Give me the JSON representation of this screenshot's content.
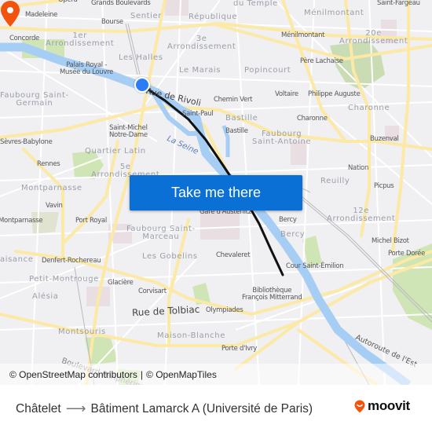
{
  "map": {
    "districts": [
      {
        "id": "sentier",
        "text": "Sentier"
      },
      {
        "id": "republique",
        "text": "République"
      },
      {
        "id": "du-temple",
        "text": "du Temple"
      },
      {
        "id": "menilmontant-dist",
        "text": "Ménilmontant"
      },
      {
        "id": "1er",
        "text": "1er\nArrondissement"
      },
      {
        "id": "3e",
        "text": "3e\nArrondissement"
      },
      {
        "id": "20e",
        "text": "20e\nArrondissement"
      },
      {
        "id": "les-halles",
        "text": "Les Halles"
      },
      {
        "id": "le-marais",
        "text": "Le Marais"
      },
      {
        "id": "popincourt",
        "text": "Popincourt"
      },
      {
        "id": "faubourg-saint-germain",
        "text": "Faubourg Saint-\nGermain"
      },
      {
        "id": "bastille-dist",
        "text": "Bastille"
      },
      {
        "id": "charonne-dist",
        "text": "Charonne"
      },
      {
        "id": "faubourg-saint-antoine",
        "text": "Faubourg\nSaint-Antoine"
      },
      {
        "id": "quartier-latin",
        "text": "Quartier Latin"
      },
      {
        "id": "5e",
        "text": "5e\nArrondissement"
      },
      {
        "id": "montparnasse",
        "text": "Montparnasse"
      },
      {
        "id": "reuilly",
        "text": "Reuilly"
      },
      {
        "id": "12e",
        "text": "12e\nArrondissement"
      },
      {
        "id": "faubourg-saint-marceau",
        "text": "Faubourg Saint-\nMarceau"
      },
      {
        "id": "bercy-dist",
        "text": "Bercy"
      },
      {
        "id": "les-gobelins",
        "text": "Les Gobelins"
      },
      {
        "id": "plaisance",
        "text": "Plaisance"
      },
      {
        "id": "petit-montrouge",
        "text": "Petit-Montrouge"
      },
      {
        "id": "alesia",
        "text": "Alésia"
      },
      {
        "id": "montsouris",
        "text": "Montsouris"
      },
      {
        "id": "maison-blanche",
        "text": "Maison-Blanche"
      }
    ],
    "pois": [
      {
        "id": "opera",
        "text": "Opéra"
      },
      {
        "id": "grands-boulevards",
        "text": "Grands Boulevards"
      },
      {
        "id": "saint-fargeau",
        "text": "Saint-Fargeau"
      },
      {
        "id": "madeleine",
        "text": "Madeleine"
      },
      {
        "id": "bourse",
        "text": "Bourse"
      },
      {
        "id": "menilmontant",
        "text": "Ménilmontant"
      },
      {
        "id": "concorde",
        "text": "Concorde"
      },
      {
        "id": "palais-royal",
        "text": "Palais Royal -\nMusée du Louvre"
      },
      {
        "id": "pere-lachaise",
        "text": "Père Lachaise"
      },
      {
        "id": "chemin-vert",
        "text": "Chemin Vert"
      },
      {
        "id": "voltaire",
        "text": "Voltaire"
      },
      {
        "id": "philippe-auguste",
        "text": "Philippe Auguste"
      },
      {
        "id": "saint-paul",
        "text": "Saint-Paul"
      },
      {
        "id": "charonne",
        "text": "Charonne"
      },
      {
        "id": "saint-michel",
        "text": "Saint-Michel\nNotre-Dame"
      },
      {
        "id": "bastille",
        "text": "Bastille"
      },
      {
        "id": "sevres-babylone",
        "text": "Sèvres-Babylone"
      },
      {
        "id": "buzenval",
        "text": "Buzenval"
      },
      {
        "id": "rennes",
        "text": "Rennes"
      },
      {
        "id": "nation",
        "text": "Nation"
      },
      {
        "id": "picpus",
        "text": "Picpus"
      },
      {
        "id": "vavin",
        "text": "Vavin"
      },
      {
        "id": "gare-austerlitz",
        "text": "Gare d'Austerlitz"
      },
      {
        "id": "bercy",
        "text": "Bercy"
      },
      {
        "id": "montparnasse-poi",
        "text": "Montparnasse"
      },
      {
        "id": "port-royal",
        "text": "Port Royal"
      },
      {
        "id": "michel-bizot",
        "text": "Michel Bizot"
      },
      {
        "id": "chevaleret",
        "text": "Chevaleret"
      },
      {
        "id": "porte-doree",
        "text": "Porte Dorée"
      },
      {
        "id": "denfert-rochereau",
        "text": "Denfert-Rochereau"
      },
      {
        "id": "cour-saint-emilion",
        "text": "Cour Saint-Émilion"
      },
      {
        "id": "glaciere",
        "text": "Glacière"
      },
      {
        "id": "corvisart",
        "text": "Corvisart"
      },
      {
        "id": "bibliotheque",
        "text": "Bibliothèque\nFrançois Mitterrand"
      },
      {
        "id": "olympiades",
        "text": "Olympiades"
      },
      {
        "id": "porte-divry",
        "text": "Porte d'Ivry"
      }
    ],
    "streets": [
      {
        "id": "rue-de-rivoli",
        "text": "Rue de Rivoli"
      },
      {
        "id": "rue-de-tolbiac",
        "text": "Rue de Tolbiac"
      },
      {
        "id": "autoroute-de-lest",
        "text": "Autoroute de l'Est"
      },
      {
        "id": "boulevard-peripherique",
        "text": "Boulevard Périphérique"
      }
    ],
    "water": [
      {
        "id": "la-seine",
        "text": "La Seine"
      }
    ],
    "origin_marker": {
      "color": "#2c7cf3"
    },
    "destination_marker": {
      "color": "#f2540d"
    },
    "route_line": {
      "color": "#111111"
    }
  },
  "cta_button": {
    "label": "Take me there",
    "color": "#0a70d5"
  },
  "attribution": {
    "osm": "© OpenStreetMap contributors",
    "separator": "|",
    "omt": "© OpenMapTiles"
  },
  "footer": {
    "origin": "Châtelet",
    "arrow": "⟶",
    "destination": "Bâtiment Lamarck A (Université de Paris)",
    "brand": "moovit",
    "brand_color": "#f2540d"
  }
}
